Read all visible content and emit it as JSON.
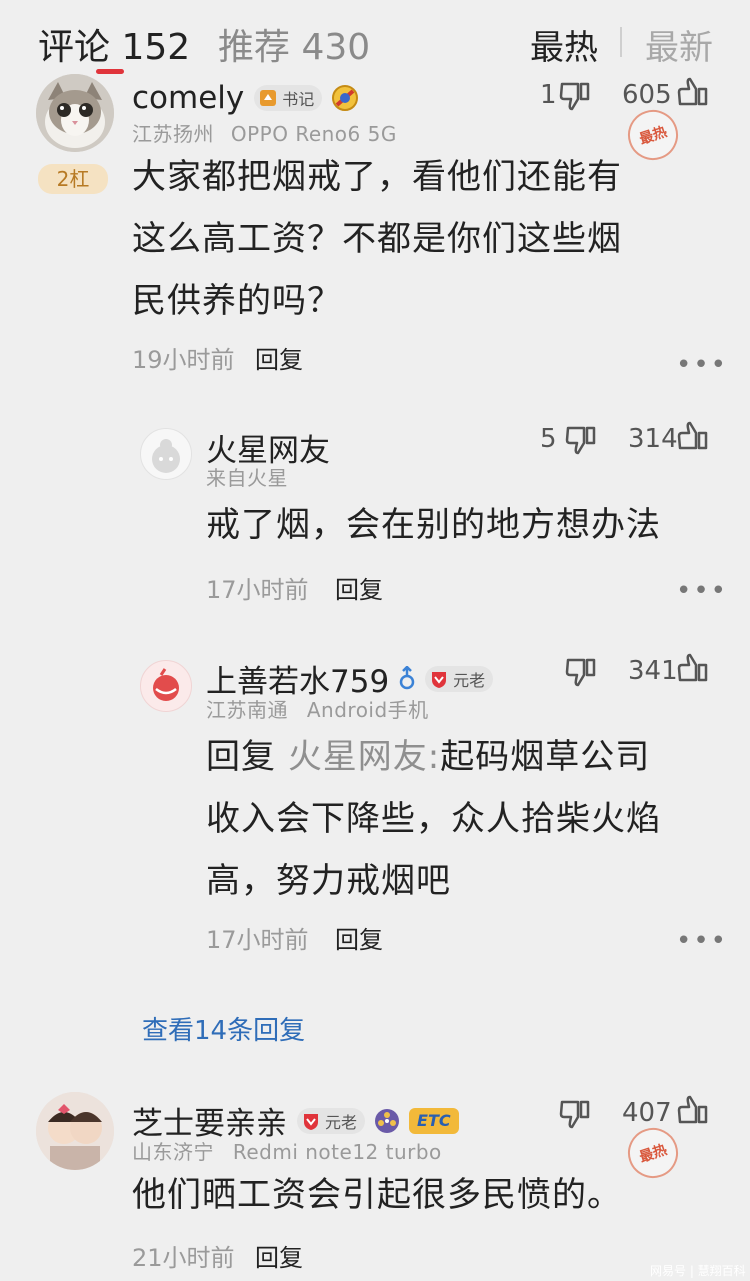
{
  "header": {
    "comments_tab": "评论 152",
    "recommend_tab": "推荐 430",
    "sort_hot": "最热",
    "sort_new": "最新"
  },
  "comments": [
    {
      "username": "comely",
      "badge": "书记",
      "location": "江苏扬州",
      "device": "OPPO Reno6 5G",
      "level": "2杠",
      "dislikes": "1",
      "likes": "605",
      "hot_label": "最热",
      "lines": [
        "大家都把烟戒了，看他们还能有",
        "这么高工资？不都是你们这些烟",
        "民供养的吗？"
      ],
      "time": "19小时前",
      "reply": "回复"
    },
    {
      "username": "芝士要亲亲",
      "badge": "元老",
      "location": "山东济宁",
      "device": "Redmi note12 turbo",
      "badge2": "ETC",
      "dislikes": "",
      "likes": "407",
      "hot_label": "最热",
      "lines": [
        "他们晒工资会引起很多民愤的。"
      ],
      "time": "21小时前",
      "reply": "回复"
    }
  ],
  "replies": [
    {
      "username": "火星网友",
      "location": "来自火星",
      "dislikes": "5",
      "likes": "314",
      "lines": [
        "戒了烟，会在别的地方想办法"
      ],
      "time": "17小时前",
      "reply": "回复"
    },
    {
      "username": "上善若水759",
      "badge": "元老",
      "location": "江苏南通",
      "device": "Android手机",
      "dislikes": "",
      "likes": "341",
      "reply_prefix": "回复",
      "reply_to": "火星网友:",
      "line1_rest": "起码烟草公司",
      "lines": [
        "收入会下降些，众人拾柴火焰",
        "高，努力戒烟吧"
      ],
      "time": "17小时前",
      "reply": "回复"
    }
  ],
  "view_more": "查看14条回复",
  "watermark": "网易号 | 慧翔百科",
  "colors": {
    "accent_red": "#e0343b",
    "link_blue": "#2f6db8",
    "level_gold": "#b77a24"
  }
}
